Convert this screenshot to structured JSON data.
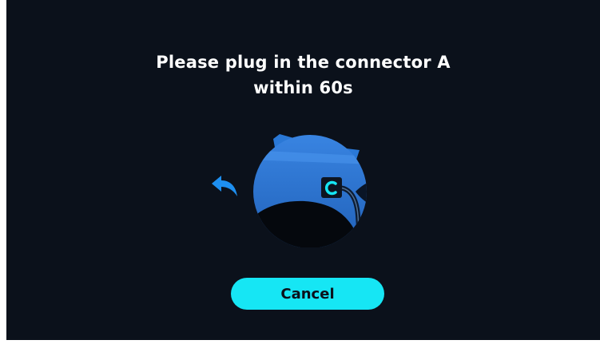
{
  "prompt": {
    "line1": "Please plug in the connector A",
    "line2": "within 60s"
  },
  "illustration": {
    "connector_letter": "C",
    "icons": [
      "back-arrow-icon",
      "car-connector-illustration"
    ]
  },
  "actions": {
    "cancel_label": "Cancel"
  },
  "colors": {
    "background": "#0b111b",
    "accent": "#16e6f4",
    "illustration_blue": "#2a78d6",
    "arrow_blue": "#1e8ff0",
    "text": "#ffffff"
  }
}
